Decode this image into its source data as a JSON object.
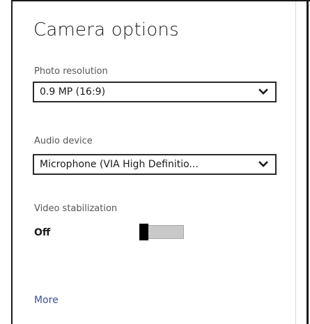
{
  "flyout": {
    "title": "Camera options",
    "photo_resolution": {
      "label": "Photo resolution",
      "value": "0.9 MP (16:9)"
    },
    "audio_device": {
      "label": "Audio device",
      "value": "Microphone (VIA High Definitio..."
    },
    "video_stabilization": {
      "label": "Video stabilization",
      "state": "Off"
    },
    "more_link": "More"
  },
  "colors": {
    "link": "#3a4fa0",
    "toggle_thumb": "#000000",
    "toggle_track": "#c9c9c9"
  },
  "icons": {
    "dropdown": "chevron-down-icon"
  }
}
